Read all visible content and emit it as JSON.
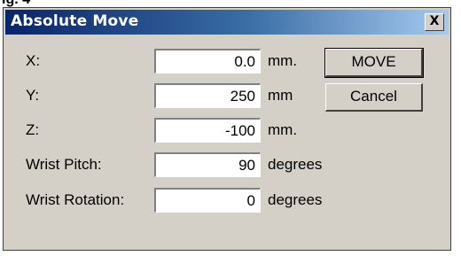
{
  "page": {
    "caption_fragment": "ig. 4"
  },
  "window": {
    "title": "Absolute Move",
    "close_glyph": "X"
  },
  "fields": [
    {
      "label": "X:",
      "value": "0.0",
      "unit": "mm."
    },
    {
      "label": "Y:",
      "value": "250",
      "unit": "mm"
    },
    {
      "label": "Z:",
      "value": "-100",
      "unit": "mm."
    },
    {
      "label": "Wrist Pitch:",
      "value": "90",
      "unit": "degrees"
    },
    {
      "label": "Wrist Rotation:",
      "value": "0",
      "unit": "degrees"
    }
  ],
  "buttons": {
    "move_label": "MOVE",
    "cancel_label": "Cancel"
  },
  "colors": {
    "dialog_face": "#d4d0c8",
    "titlebar_start": "#0a246a",
    "titlebar_end": "#a6caf0"
  }
}
